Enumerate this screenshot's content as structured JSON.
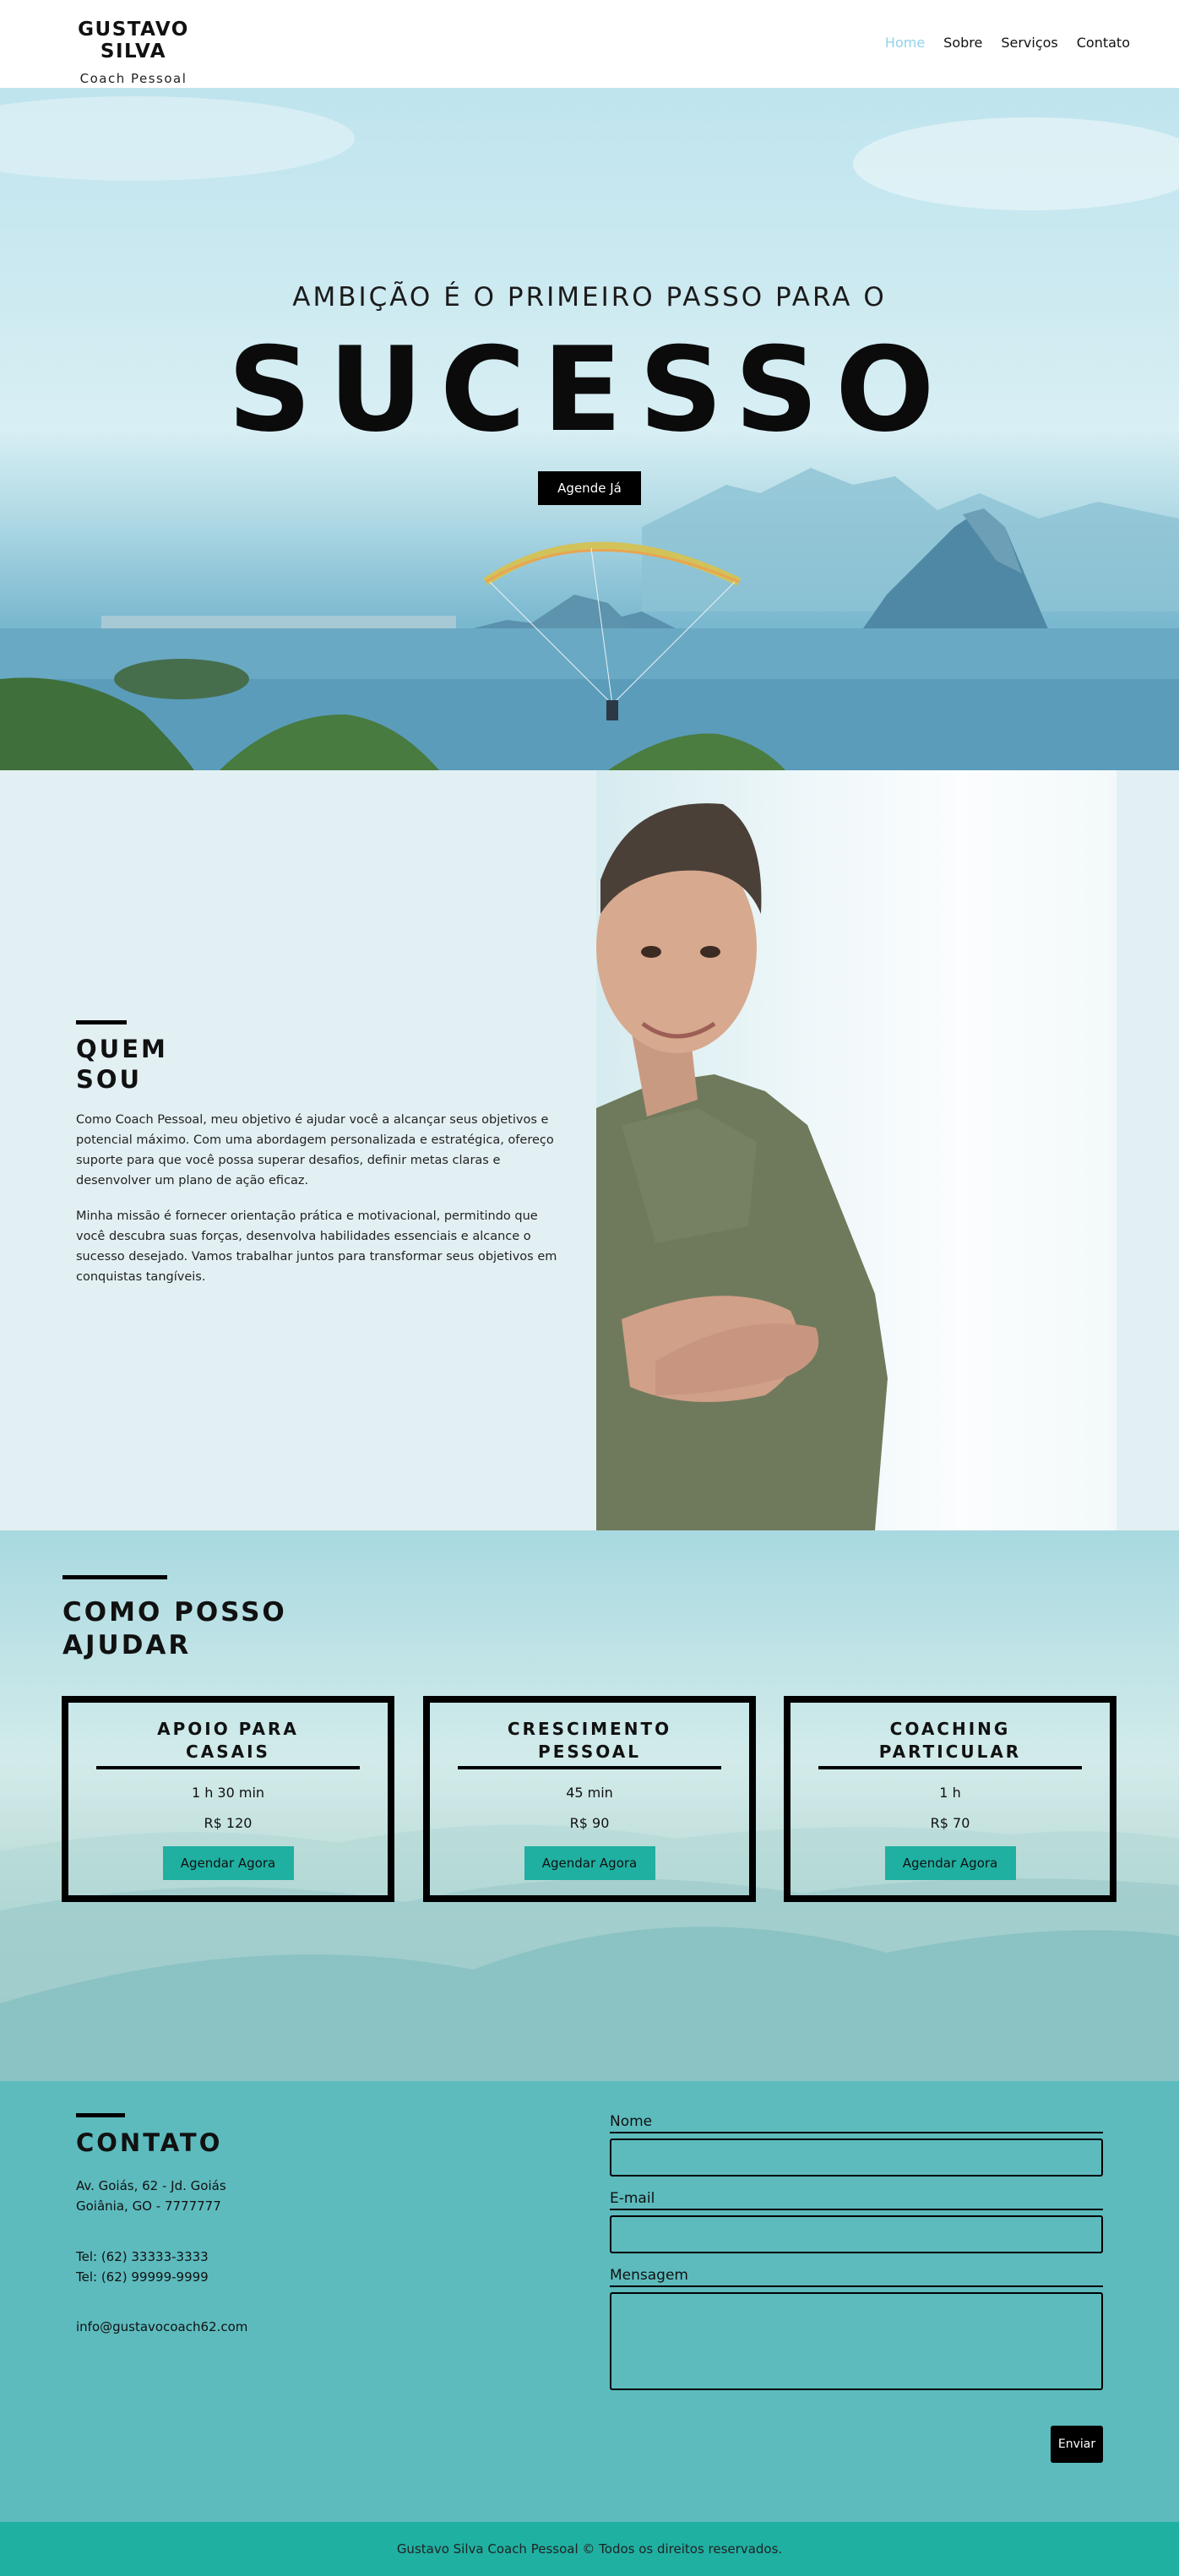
{
  "header": {
    "brand_name": "GUSTAVO SILVA",
    "brand_sub": "Coach Pessoal",
    "nav": [
      "Home",
      "Sobre",
      "Serviços",
      "Contato"
    ]
  },
  "hero": {
    "tagline": "AMBIÇÃO É O PRIMEIRO PASSO PARA O",
    "title": "SUCESSO",
    "cta": "Agende Já"
  },
  "about": {
    "title_line1": "QUEM",
    "title_line2": "SOU",
    "p1": "Como Coach Pessoal, meu objetivo é ajudar você a alcançar seus objetivos e potencial máximo. Com uma abordagem personalizada e estratégica, ofereço suporte para que você possa superar desafios, definir metas claras e desenvolver um plano de ação eficaz.",
    "p2": "Minha missão é fornecer orientação prática e motivacional, permitindo que você descubra suas forças, desenvolva habilidades essenciais e alcance o sucesso desejado. Vamos trabalhar juntos para transformar seus objetivos em conquistas tangíveis."
  },
  "services": {
    "title_line1": "COMO POSSO",
    "title_line2": "AJUDAR",
    "cards": [
      {
        "title1": "APOIO PARA",
        "title2": "CASAIS",
        "duration": "1 h 30 min",
        "price": "R$ 120",
        "button": "Agendar Agora"
      },
      {
        "title1": "CRESCIMENTO",
        "title2": "PESSOAL",
        "duration": "45 min",
        "price": "R$ 90",
        "button": "Agendar Agora"
      },
      {
        "title1": "COACHING",
        "title2": "PARTICULAR",
        "duration": "1 h",
        "price": "R$ 70",
        "button": "Agendar Agora"
      }
    ]
  },
  "contact": {
    "title": "CONTATO",
    "address1": "Av. Goiás, 62 - Jd. Goiás",
    "address2": "Goiânia, GO - 7777777",
    "tel1": "Tel: (62) 33333-3333",
    "tel2": "Tel: (62) 99999-9999",
    "email": "info@gustavocoach62.com",
    "form": {
      "name_label": "Nome",
      "email_label": "E-mail",
      "message_label": "Mensagem",
      "submit": "Enviar"
    }
  },
  "footer": {
    "text": "Gustavo Silva Coach Pessoal © Todos os direitos reservados."
  },
  "colors": {
    "accent": "#1fb0a2",
    "nav_active": "#8fd3e8",
    "contact_bg": "#5dbbbe"
  }
}
